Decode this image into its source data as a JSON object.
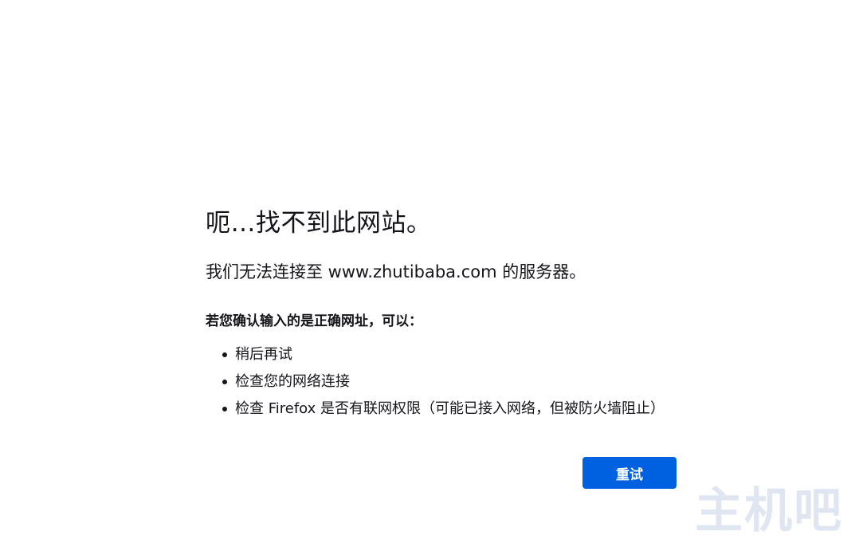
{
  "error": {
    "title": "呃…找不到此网站。",
    "description": "我们无法连接至 www.zhutibaba.com 的服务器。",
    "advice_heading": "若您确认输入的是正确网址，可以：",
    "advice_items": [
      "稍后再试",
      "检查您的网络连接",
      "检查 Firefox 是否有联网权限（可能已接入网络，但被防火墙阻止）"
    ]
  },
  "actions": {
    "retry_label": "重试"
  },
  "watermark": {
    "text": "主机吧"
  },
  "colors": {
    "primary_button": "#0061e0",
    "text": "#15141a",
    "background": "#ffffff"
  }
}
